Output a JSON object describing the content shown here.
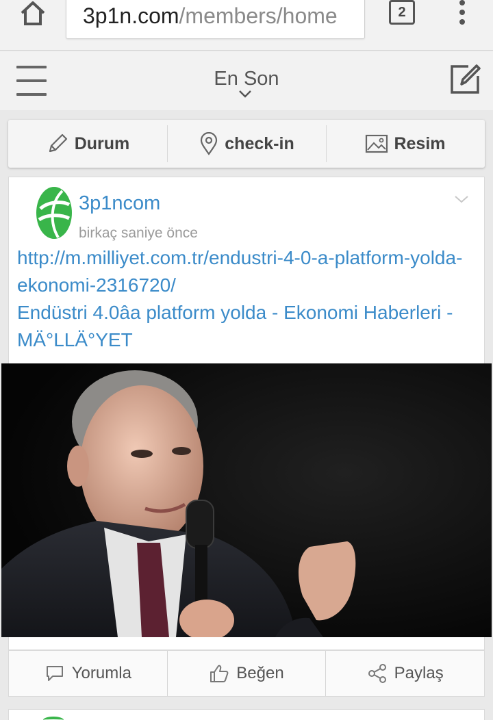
{
  "browser": {
    "url_domain": "3p1n.com",
    "url_path": "/members/home",
    "tab_count": "2"
  },
  "header": {
    "title": "En Son"
  },
  "post_bar": {
    "status_label": "Durum",
    "checkin_label": "check-in",
    "image_label": "Resim"
  },
  "post": {
    "author": "3p1ncom",
    "time": "birkaç saniye önce",
    "link_url": "http://m.milliyet.com.tr/endustri-4-0-a-platform-yolda-ekonomi-2316720/",
    "link_title": "Endüstri 4.0âa platform yolda - Ekonomi Haberleri - MÄ°LLÄ°YET",
    "brand_color": "#3b8bc9",
    "logo_color": "#39b54a"
  },
  "interactions": {
    "comment_label": "Yorumla",
    "like_label": "Beğen",
    "share_label": "Paylaş"
  }
}
